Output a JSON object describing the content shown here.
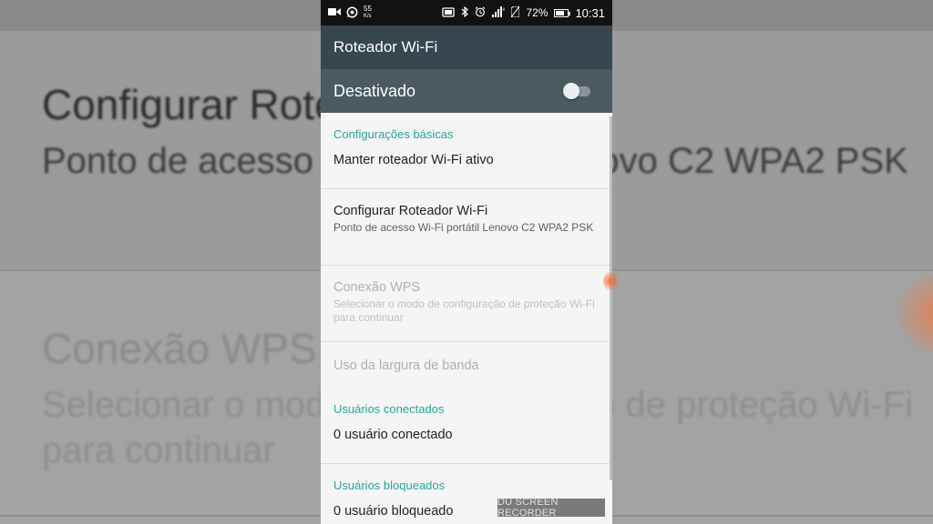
{
  "background": {
    "title": "Configurar Roteador Wi-Fi",
    "summary": "Ponto de acesso Wi-Fi portátil Lenovo C2 WPA2 PSK",
    "title2": "Conexão WPS",
    "summary2": "Selecionar o modo de configuração de proteção Wi-Fi para continuar"
  },
  "status_bar": {
    "speed_value": "55",
    "speed_unit": "K/s",
    "battery": "72%",
    "battery_level": 0.72,
    "time": "10:31"
  },
  "app_bar": {
    "title": "Roteador Wi-Fi"
  },
  "switch_bar": {
    "label": "Desativado",
    "checked": false
  },
  "sections": {
    "basic": "Configurações básicas",
    "connected": "Usuários conectados",
    "blocked": "Usuários bloqueados"
  },
  "prefs": {
    "keep_active": {
      "title": "Manter roteador Wi-Fi ativo"
    },
    "configure": {
      "title": "Configurar Roteador Wi-Fi",
      "summary": "Ponto de acesso Wi-Fi portátil Lenovo C2 WPA2 PSK"
    },
    "wps": {
      "title": "Conexão WPS",
      "summary": "Selecionar o modo de configuração de proteção Wi-Fi para continuar"
    },
    "bandwidth": {
      "title": "Uso da largura de banda"
    },
    "connected_users": {
      "title": "0 usuário conectado"
    },
    "blocked_users": {
      "title": "0 usuário bloqueado"
    }
  },
  "watermark": "DU SCREEN RECORDER",
  "colors": {
    "app_bar": "#37474f",
    "switch_bar": "#4a5a60",
    "accent": "#26a69a"
  }
}
